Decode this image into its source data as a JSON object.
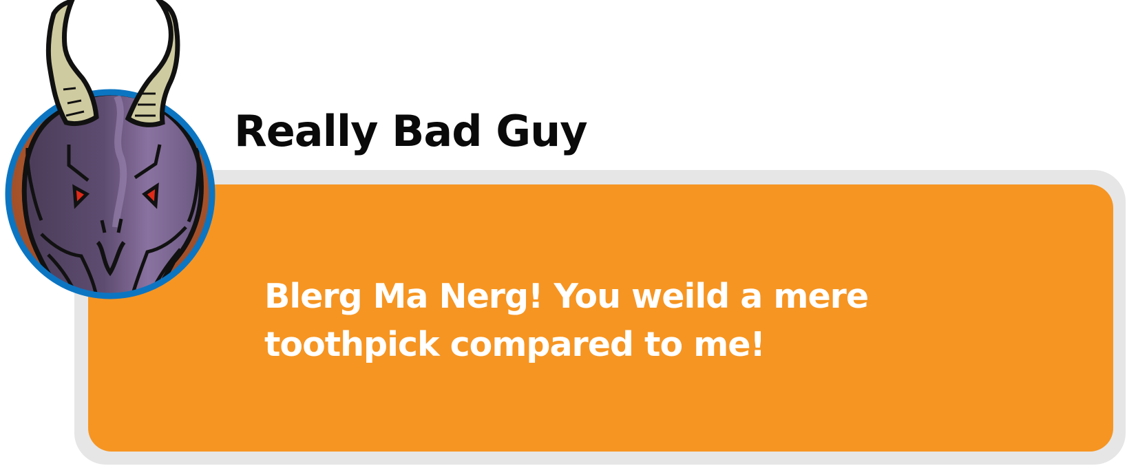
{
  "speaker": {
    "name": "Really Bad Guy"
  },
  "dialog": {
    "text": "Blerg Ma Nerg! You weild a mere toothpick compared to me!"
  },
  "portrait": {
    "icon": "demon-portrait-icon",
    "ring_color": "#0c75c2",
    "background_color": "#b05a30",
    "head_color": "#6e5a80",
    "horn_color": "#cfcba0",
    "eye_color": "#e02a1a"
  },
  "colors": {
    "panel": "#f69522",
    "panel_border": "#e6e6e6",
    "name_text": "#0a0a0a",
    "dialog_text": "#ffffff"
  }
}
